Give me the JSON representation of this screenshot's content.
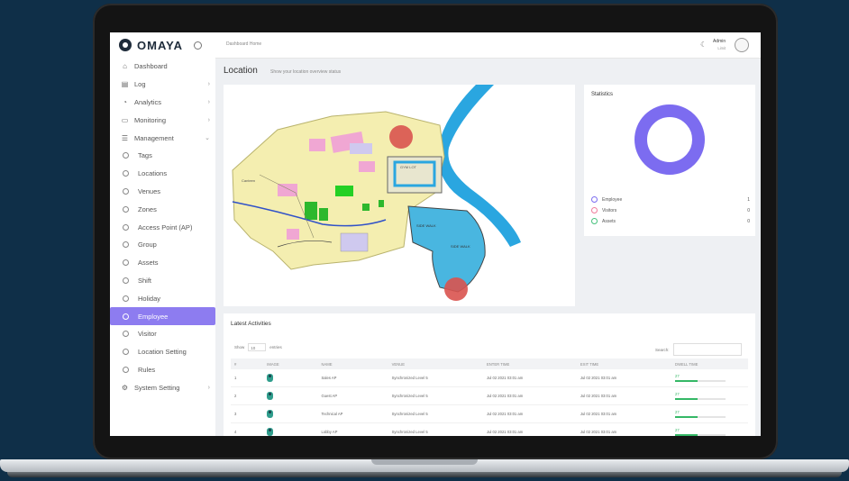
{
  "brand": {
    "name": "OMAYA"
  },
  "topbar": {
    "breadcrumb": "Dashboard Home",
    "user_name": "Admin",
    "user_role": "Limit"
  },
  "page": {
    "title": "Location",
    "subtitle": "Show your location overview status"
  },
  "sidebar": {
    "items": [
      {
        "label": "Dashboard",
        "icon": "dashboard-icon",
        "chevron": false
      },
      {
        "label": "Log",
        "icon": "log-icon",
        "chevron": true
      },
      {
        "label": "Analytics",
        "icon": "analytics-icon",
        "chevron": true
      },
      {
        "label": "Monitoring",
        "icon": "monitoring-icon",
        "chevron": true
      },
      {
        "label": "Management",
        "icon": "management-icon",
        "chevron": true,
        "expanded": true
      },
      {
        "label": "Tags",
        "sub": true
      },
      {
        "label": "Locations",
        "sub": true
      },
      {
        "label": "Venues",
        "sub": true
      },
      {
        "label": "Zones",
        "sub": true
      },
      {
        "label": "Access Point (AP)",
        "sub": true
      },
      {
        "label": "Group",
        "sub": true
      },
      {
        "label": "Assets",
        "sub": true
      },
      {
        "label": "Shift",
        "sub": true
      },
      {
        "label": "Holiday",
        "sub": true
      },
      {
        "label": "Employee",
        "sub": true,
        "active": true
      },
      {
        "label": "Visitor",
        "sub": true
      },
      {
        "label": "Location Setting",
        "sub": true
      },
      {
        "label": "Rules",
        "sub": true
      },
      {
        "label": "System Setting",
        "icon": "settings-icon",
        "chevron": true
      }
    ]
  },
  "map": {
    "labels": [
      "Canteen",
      "GYM LOT",
      "SIDE WALK",
      "SIDE WALK"
    ]
  },
  "statistics": {
    "title": "Statistics",
    "ring_color": "#7c6cf0",
    "legend": [
      {
        "label": "Employee",
        "value": "1",
        "color": "#7c6cf0"
      },
      {
        "label": "Visitors",
        "value": "0",
        "color": "#f07c9c"
      },
      {
        "label": "Assets",
        "value": "0",
        "color": "#46c17c"
      }
    ]
  },
  "activities": {
    "title": "Latest Activities",
    "show_label": "Show",
    "show_value": "10",
    "entries_label": "entries",
    "search_label": "Search:",
    "columns": [
      "#",
      "IMAGE",
      "NAME",
      "VENUE",
      "ENTER TIME",
      "EXIT TIME",
      "DWELL TIME"
    ],
    "rows": [
      {
        "no": "1",
        "name": "Sales AP",
        "venue": "Synchronized Level 5",
        "enter": "Jul 02 2021 03:01 am",
        "exit": "Jul 02 2021 03:01 am",
        "dwell": "27",
        "fill": 0.45
      },
      {
        "no": "2",
        "name": "Guest AP",
        "venue": "Synchronized Level 5",
        "enter": "Jul 02 2021 03:01 am",
        "exit": "Jul 02 2021 03:01 am",
        "dwell": "27",
        "fill": 0.45
      },
      {
        "no": "3",
        "name": "Technical AP",
        "venue": "Synchronized Level 5",
        "enter": "Jul 02 2021 03:01 am",
        "exit": "Jul 02 2021 03:01 am",
        "dwell": "27",
        "fill": 0.45
      },
      {
        "no": "4",
        "name": "Lobby AP",
        "venue": "Synchronized Level 5",
        "enter": "Jul 02 2021 03:01 am",
        "exit": "Jul 02 2021 03:01 am",
        "dwell": "27",
        "fill": 0.45
      }
    ]
  }
}
